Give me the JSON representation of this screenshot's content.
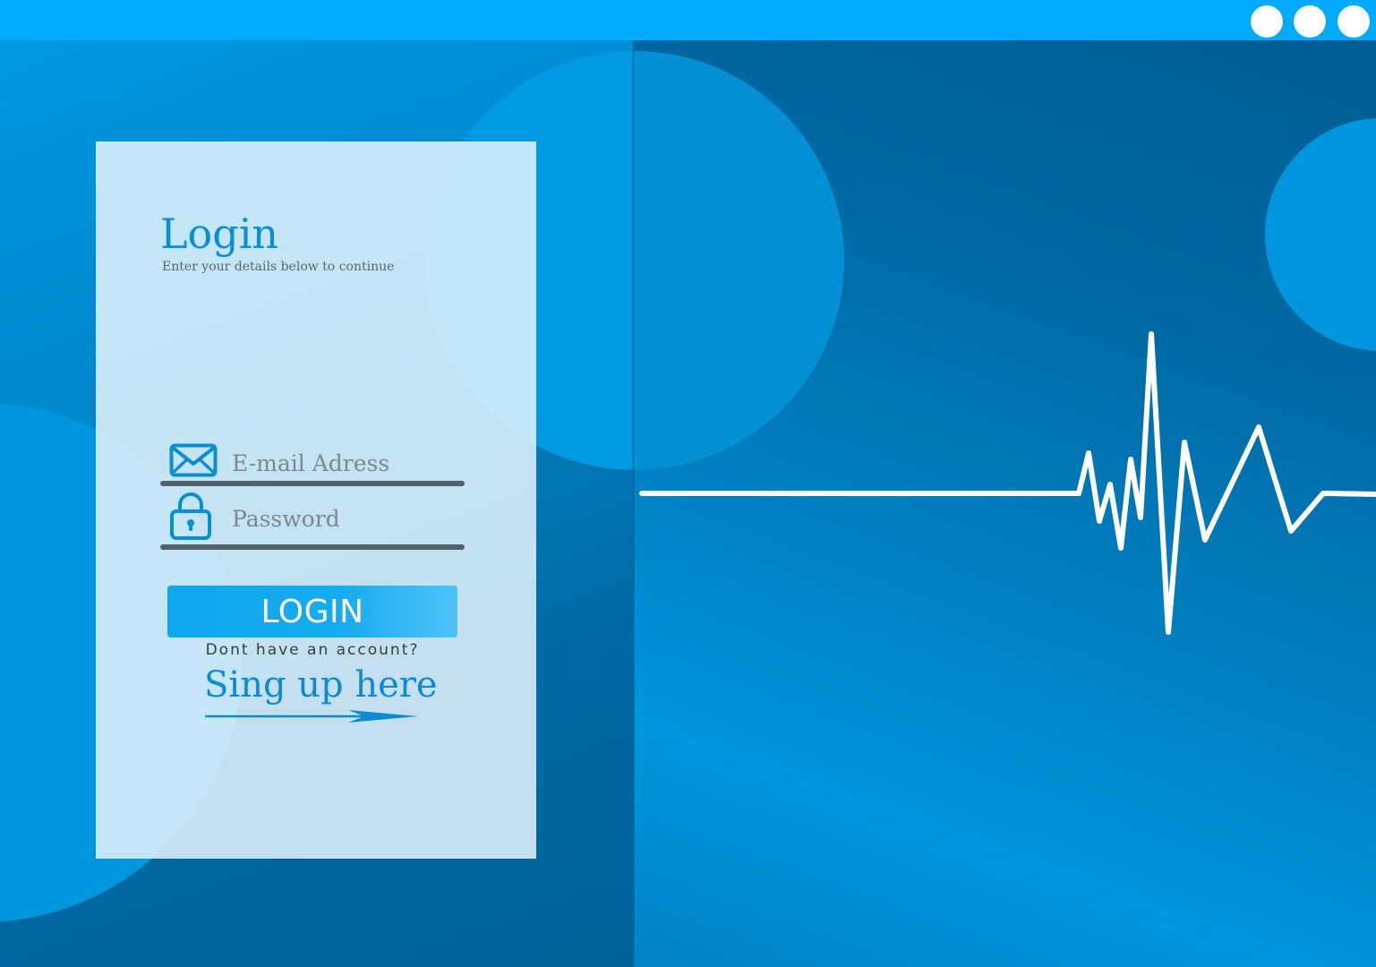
{
  "window": {
    "title_bar_color": "#00aaff",
    "controls": [
      "window-button",
      "window-button",
      "window-button"
    ]
  },
  "login": {
    "title": "Login",
    "subtitle": "Enter your details below to continue",
    "email_placeholder": "E-mail Adress",
    "password_placeholder": "Password",
    "button_label": "LOGIN",
    "no_account_text": "Dont have an account?",
    "signup_link": "Sing up here"
  },
  "icons": {
    "email": "envelope-icon",
    "password": "lock-icon",
    "signup_arrow": "arrow-right-icon",
    "decor": "heartbeat-line"
  },
  "colors": {
    "accent": "#0a8ed2",
    "button": "#17abef",
    "background_dark": "#0069a0",
    "background_light": "#0098e0",
    "card": "#e6f4fc"
  }
}
